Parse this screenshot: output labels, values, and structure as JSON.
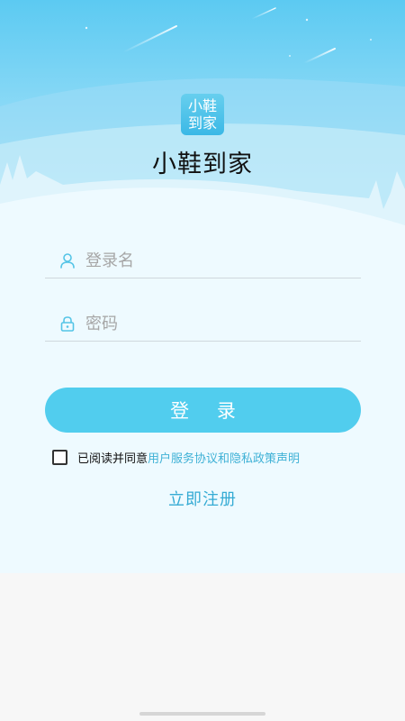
{
  "app": {
    "logo_line1": "小鞋",
    "logo_line2": "到家",
    "title": "小鞋到家"
  },
  "form": {
    "username_placeholder": "登录名",
    "username_icon": "user-icon",
    "password_placeholder": "密码",
    "password_icon": "lock-icon",
    "login_label": "登 录"
  },
  "agreement": {
    "checked": false,
    "prefix": "已阅读并同意",
    "link": "用户服务协议和隐私政策声明"
  },
  "register_label": "立即注册",
  "colors": {
    "accent": "#51cdee",
    "link": "#3fb1d6",
    "sky_top": "#5ccaf2",
    "sky_bottom": "#eefaff"
  }
}
